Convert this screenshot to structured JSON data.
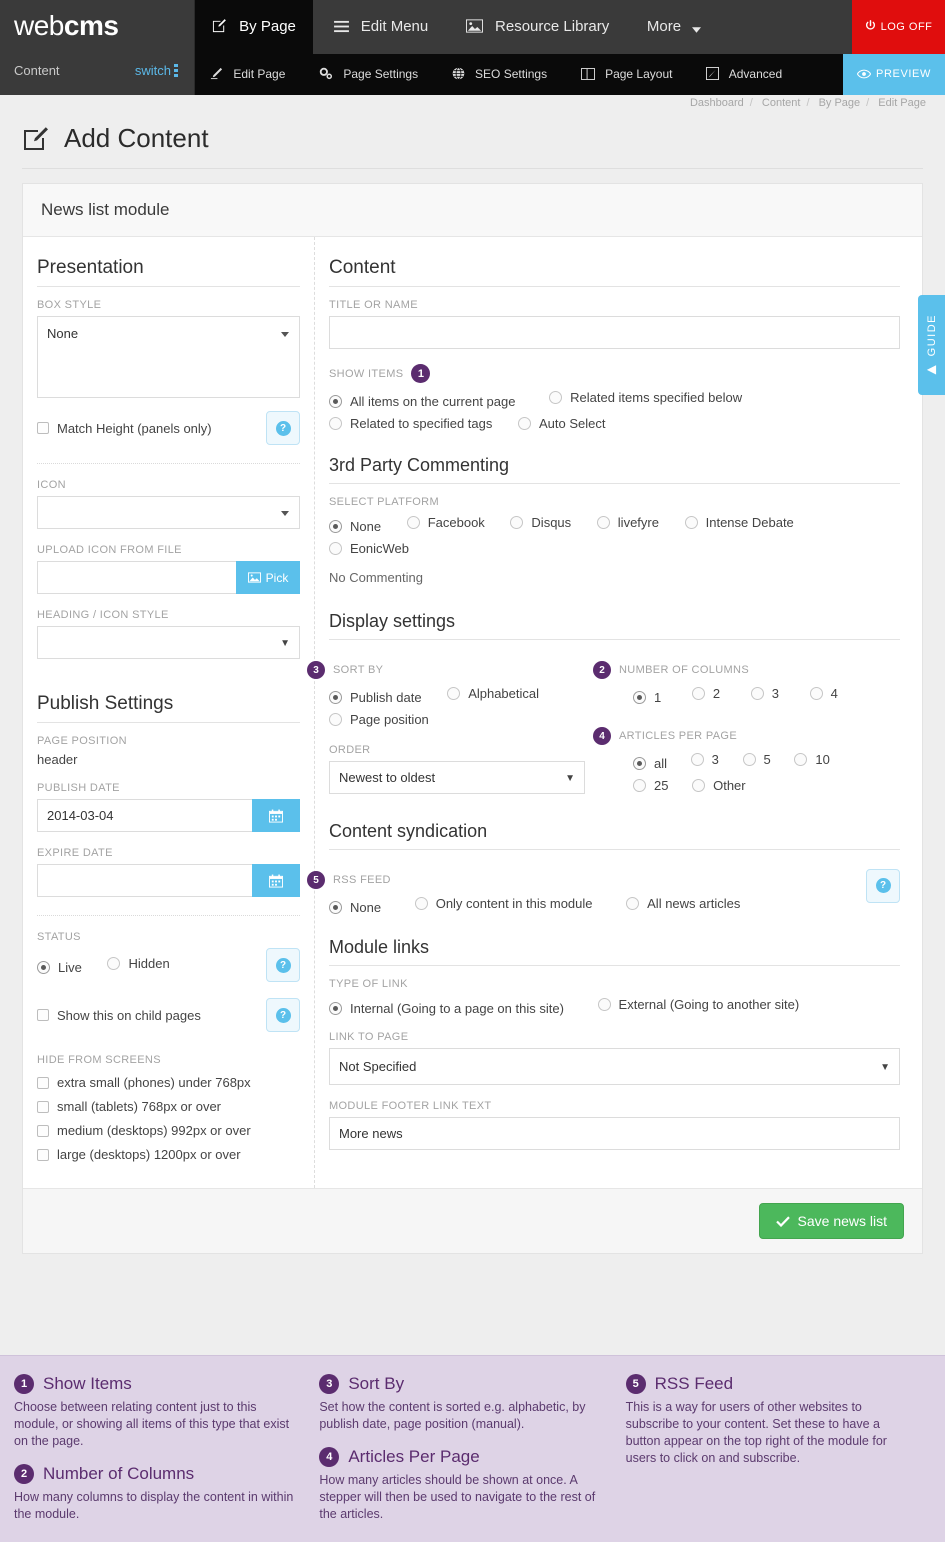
{
  "header": {
    "brand_light": "web",
    "brand_bold": "cms",
    "brand_sub": "Content",
    "switch_label": "switch",
    "logoff_label": "LOG OFF",
    "preview_label": "PREVIEW",
    "main_nav": [
      {
        "label": "By Page",
        "icon": "edit-square-icon",
        "active": true
      },
      {
        "label": "Edit Menu",
        "icon": "hamburger-icon",
        "active": false
      },
      {
        "label": "Resource Library",
        "icon": "image-icon",
        "active": false
      },
      {
        "label": "More",
        "icon": "caret-down-icon",
        "active": false
      }
    ],
    "sub_nav": [
      {
        "label": "Edit Page",
        "icon": "pencil-icon"
      },
      {
        "label": "Page Settings",
        "icon": "gears-icon"
      },
      {
        "label": "SEO Settings",
        "icon": "globe-icon"
      },
      {
        "label": "Page Layout",
        "icon": "columns-icon"
      },
      {
        "label": "Advanced",
        "icon": "wrench-icon"
      }
    ]
  },
  "breadcrumb": [
    "Dashboard",
    "Content",
    "By Page",
    "Edit Page"
  ],
  "page": {
    "title": "Add Content",
    "title_icon": "edit-square-icon",
    "module_title": "News list module"
  },
  "guide_tab": {
    "label": "GUIDE",
    "arrow": "◀"
  },
  "presentation": {
    "heading": "Presentation",
    "box_style_label": "BOX STYLE",
    "box_style_value": "None",
    "match_height_label": "Match Height (panels only)",
    "match_height_checked": false,
    "icon_label": "ICON",
    "icon_value": "",
    "upload_icon_label": "UPLOAD ICON FROM FILE",
    "upload_icon_value": "",
    "pick_label": "Pick",
    "heading_icon_style_label": "HEADING / ICON STYLE",
    "heading_icon_style_value": ""
  },
  "publish": {
    "heading": "Publish Settings",
    "page_position_label": "PAGE POSITION",
    "page_position_value": "header",
    "publish_date_label": "PUBLISH DATE",
    "publish_date_value": "2014-03-04",
    "expire_date_label": "EXPIRE DATE",
    "expire_date_value": "",
    "status_label": "STATUS",
    "status_options": [
      {
        "label": "Live",
        "selected": true
      },
      {
        "label": "Hidden",
        "selected": false
      }
    ],
    "show_child_label": "Show this on child pages",
    "show_child_checked": false,
    "hide_screens_label": "HIDE FROM SCREENS",
    "hide_screens": [
      {
        "label": "extra small (phones) under 768px",
        "checked": false
      },
      {
        "label": "small (tablets) 768px or over",
        "checked": false
      },
      {
        "label": "medium (desktops) 992px or over",
        "checked": false
      },
      {
        "label": "large (desktops) 1200px or over",
        "checked": false
      }
    ]
  },
  "content": {
    "heading": "Content",
    "title_label": "TITLE OR NAME",
    "title_value": "",
    "show_items_label": "SHOW ITEMS",
    "show_items_badge": "1",
    "show_items_options": [
      {
        "label": "All items on the current page",
        "selected": true
      },
      {
        "label": "Related items specified below",
        "selected": false
      },
      {
        "label": "Related to specified tags",
        "selected": false
      },
      {
        "label": "Auto Select",
        "selected": false
      }
    ]
  },
  "commenting": {
    "heading": "3rd Party Commenting",
    "platform_label": "SELECT PLATFORM",
    "platforms": [
      {
        "label": "None",
        "selected": true
      },
      {
        "label": "Facebook",
        "selected": false
      },
      {
        "label": "Disqus",
        "selected": false
      },
      {
        "label": "livefyre",
        "selected": false
      },
      {
        "label": "Intense Debate",
        "selected": false
      },
      {
        "label": "EonicWeb",
        "selected": false
      }
    ],
    "status_note": "No Commenting"
  },
  "display": {
    "heading": "Display settings",
    "sort_by_label": "SORT BY",
    "sort_by_badge": "3",
    "sort_by_options": [
      {
        "label": "Publish date",
        "selected": true
      },
      {
        "label": "Alphabetical",
        "selected": false
      },
      {
        "label": "Page position",
        "selected": false
      }
    ],
    "order_label": "ORDER",
    "order_value": "Newest to oldest",
    "columns_label": "NUMBER OF COLUMNS",
    "columns_badge": "2",
    "columns_options": [
      {
        "label": "1",
        "selected": true
      },
      {
        "label": "2",
        "selected": false
      },
      {
        "label": "3",
        "selected": false
      },
      {
        "label": "4",
        "selected": false
      }
    ],
    "per_page_label": "ARTICLES PER PAGE",
    "per_page_badge": "4",
    "per_page_options": [
      {
        "label": "all",
        "selected": true
      },
      {
        "label": "3",
        "selected": false
      },
      {
        "label": "5",
        "selected": false
      },
      {
        "label": "10",
        "selected": false
      },
      {
        "label": "25",
        "selected": false
      },
      {
        "label": "Other",
        "selected": false
      }
    ]
  },
  "syndication": {
    "heading": "Content syndication",
    "rss_label": "RSS FEED",
    "rss_badge": "5",
    "rss_options": [
      {
        "label": "None",
        "selected": true
      },
      {
        "label": "Only content in this module",
        "selected": false
      },
      {
        "label": "All news articles",
        "selected": false
      }
    ]
  },
  "module_links": {
    "heading": "Module links",
    "type_label": "TYPE OF LINK",
    "type_options": [
      {
        "label": "Internal (Going to a page on this site)",
        "selected": true
      },
      {
        "label": "External (Going to another site)",
        "selected": false
      }
    ],
    "link_to_page_label": "LINK TO PAGE",
    "link_to_page_value": "Not Specified",
    "footer_link_label": "MODULE FOOTER LINK TEXT",
    "footer_link_value": "More news"
  },
  "footer": {
    "save_label": "Save news list"
  },
  "legend": {
    "col1": [
      {
        "num": "1",
        "title": "Show Items",
        "text": "Choose between relating content just to this module, or showing all items of this type that exist on the page."
      },
      {
        "num": "2",
        "title": "Number of Columns",
        "text": "How many columns to display the content in within the module."
      }
    ],
    "col2": [
      {
        "num": "3",
        "title": "Sort By",
        "text": "Set how the content is sorted e.g. alphabetic, by publish date, page position (manual)."
      },
      {
        "num": "4",
        "title": "Articles Per Page",
        "text": "How many articles should be shown at once. A stepper will then be used to navigate to the rest of the articles."
      }
    ],
    "col3": [
      {
        "num": "5",
        "title": "RSS Feed",
        "text": "This is a way for users of other websites to subscribe to your content. Set these to have a button appear on the top right of the module for users to click on and subscribe."
      }
    ]
  },
  "colors": {
    "accent_blue": "#5bc0eb",
    "purple": "#5b2c6f",
    "green": "#4cb85c",
    "red": "#e00d0d",
    "legend_bg": "#ded3e6"
  }
}
